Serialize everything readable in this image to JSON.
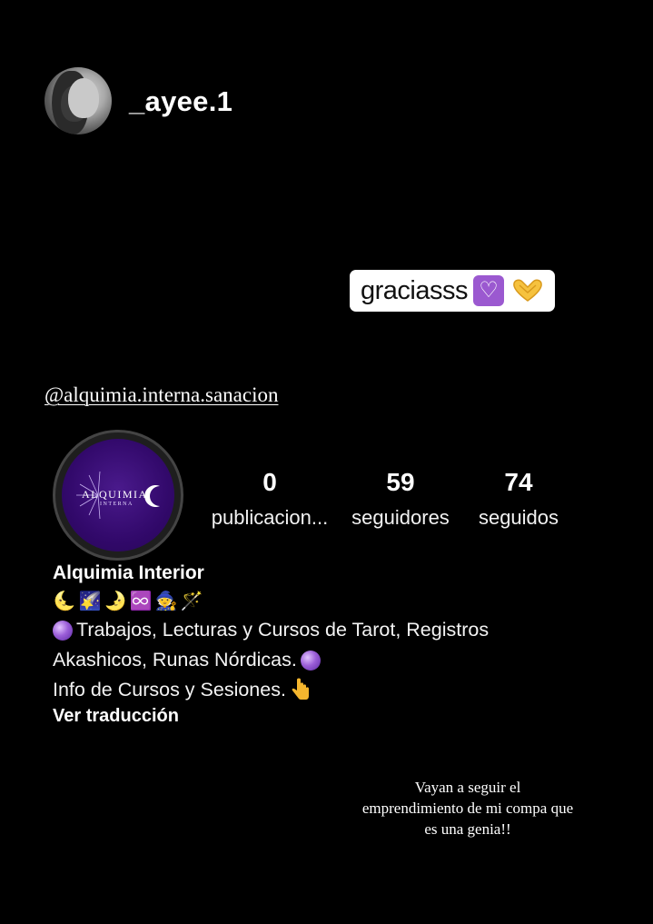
{
  "story": {
    "username": "_ayee.1"
  },
  "sticker": {
    "text": "graciasss",
    "emojis": [
      "purple-heart",
      "heart-hands"
    ]
  },
  "mention": "@alquimia.interna.sanacion",
  "profile": {
    "avatar_logo_text": "ALQUIMIA",
    "avatar_logo_subtext": "INTERNA",
    "stats": {
      "posts_count": "0",
      "posts_label": "publicacion...",
      "followers_count": "59",
      "followers_label": "seguidores",
      "following_count": "74",
      "following_label": "seguidos"
    },
    "name": "Alquimia Interior",
    "emoji_row": [
      "🌜",
      "🌠",
      "🌛",
      "♾️",
      "🧙",
      "🪄"
    ],
    "bio_line_1": "Trabajos, Lecturas y Cursos de Tarot, Registros",
    "bio_line_2": "Akashicos, Runas Nórdicas.",
    "bio_line_3": "Info de Cursos y Sesiones.",
    "see_translation": "Ver traducción"
  },
  "caption": {
    "line_1": "Vayan a seguir el",
    "line_2": "emprendimiento de mi compa que",
    "line_3": "es una genia!!"
  },
  "colors": {
    "background": "#000000",
    "avatar_purple": "#32096b",
    "sticker_bg": "#ffffff"
  }
}
